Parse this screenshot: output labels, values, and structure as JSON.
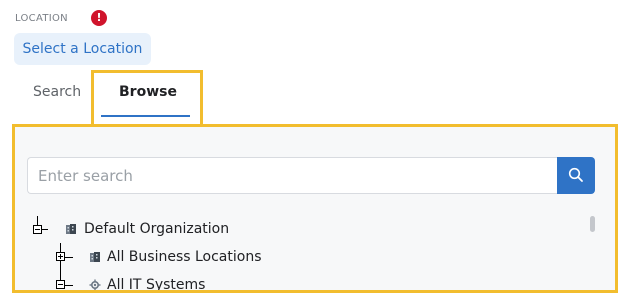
{
  "location": {
    "label": "LOCATION",
    "required_icon": "!",
    "select_button_label": "Select a Location"
  },
  "tabs": [
    {
      "label": "Search",
      "active": false
    },
    {
      "label": "Browse",
      "active": true
    }
  ],
  "search": {
    "placeholder": "Enter search",
    "value": ""
  },
  "tree": [
    {
      "label": "Default Organization",
      "icon": "organization-icon",
      "expanded": true
    },
    {
      "label": "All Business Locations",
      "icon": "business-locations-icon",
      "expanded": false
    },
    {
      "label": "All IT Systems",
      "icon": "it-systems-gear-icon",
      "expanded": true
    }
  ],
  "colors": {
    "accent": "#2f73c6",
    "highlight": "#f2bd2e",
    "required": "#d0142c"
  }
}
